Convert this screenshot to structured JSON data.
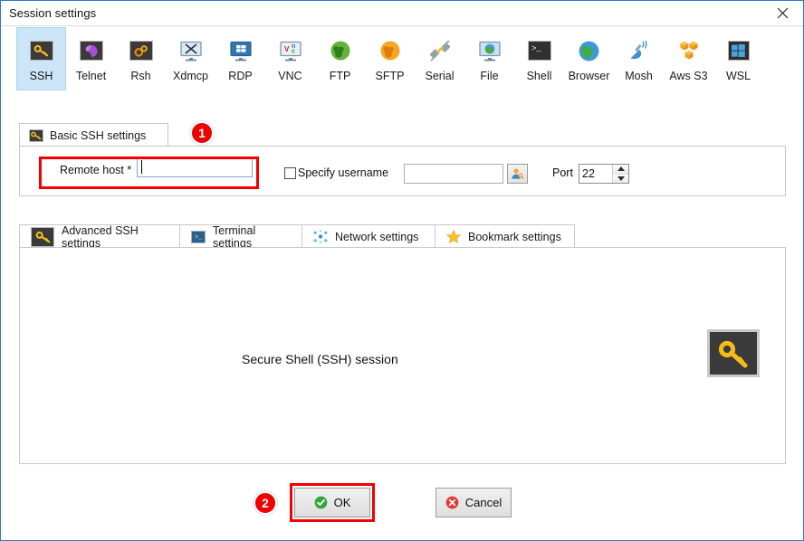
{
  "window": {
    "title": "Session settings",
    "close_icon": "close-icon"
  },
  "toolbar": {
    "items": [
      {
        "label": "SSH",
        "icon": "key-icon",
        "selected": true
      },
      {
        "label": "Telnet",
        "icon": "telnet-gem-icon",
        "selected": false
      },
      {
        "label": "Rsh",
        "icon": "gears-icon",
        "selected": false
      },
      {
        "label": "Xdmcp",
        "icon": "monitor-x-icon",
        "selected": false
      },
      {
        "label": "RDP",
        "icon": "monitor-windows-icon",
        "selected": false
      },
      {
        "label": "VNC",
        "icon": "monitor-vnc-icon",
        "selected": false
      },
      {
        "label": "FTP",
        "icon": "globe-green-icon",
        "selected": false
      },
      {
        "label": "SFTP",
        "icon": "globe-orange-icon",
        "selected": false
      },
      {
        "label": "Serial",
        "icon": "plug-icon",
        "selected": false
      },
      {
        "label": "File",
        "icon": "monitor-globe-icon",
        "selected": false
      },
      {
        "label": "Shell",
        "icon": "terminal-icon",
        "selected": false
      },
      {
        "label": "Browser",
        "icon": "globe-blue-icon",
        "selected": false
      },
      {
        "label": "Mosh",
        "icon": "satellite-icon",
        "selected": false
      },
      {
        "label": "Aws S3",
        "icon": "aws-cubes-icon",
        "selected": false
      },
      {
        "label": "WSL",
        "icon": "windows-icon",
        "selected": false
      }
    ]
  },
  "basic": {
    "tab_label": "Basic SSH settings",
    "tab_icon": "key-icon",
    "remote_host_label": "Remote host *",
    "remote_host_value": "",
    "specify_username_label": "Specify username",
    "specify_username_checked": false,
    "username_value": "",
    "user_button_icon": "user-key-icon",
    "port_label": "Port",
    "port_value": "22"
  },
  "subtabs": [
    {
      "label": "Advanced SSH settings",
      "icon": "key-icon",
      "active": false
    },
    {
      "label": "Terminal settings",
      "icon": "terminal-blue-icon",
      "active": false
    },
    {
      "label": "Network settings",
      "icon": "network-dots-icon",
      "active": false
    },
    {
      "label": "Bookmark settings",
      "icon": "star-icon",
      "active": false
    }
  ],
  "content": {
    "caption": "Secure Shell (SSH) session",
    "icon": "big-key-icon"
  },
  "footer": {
    "ok_label": "OK",
    "ok_icon": "check-circle-icon",
    "cancel_label": "Cancel",
    "cancel_icon": "x-circle-icon"
  },
  "annotations": [
    {
      "badge": "1"
    },
    {
      "badge": "2"
    }
  ],
  "colors": {
    "accent": "#2b7cc0",
    "selected_tile": "#cce6f7",
    "annotation_red": "#ee0000",
    "key_yellow": "#f5bb17",
    "ok_green": "#2faa36",
    "cancel_red": "#e23b33"
  }
}
